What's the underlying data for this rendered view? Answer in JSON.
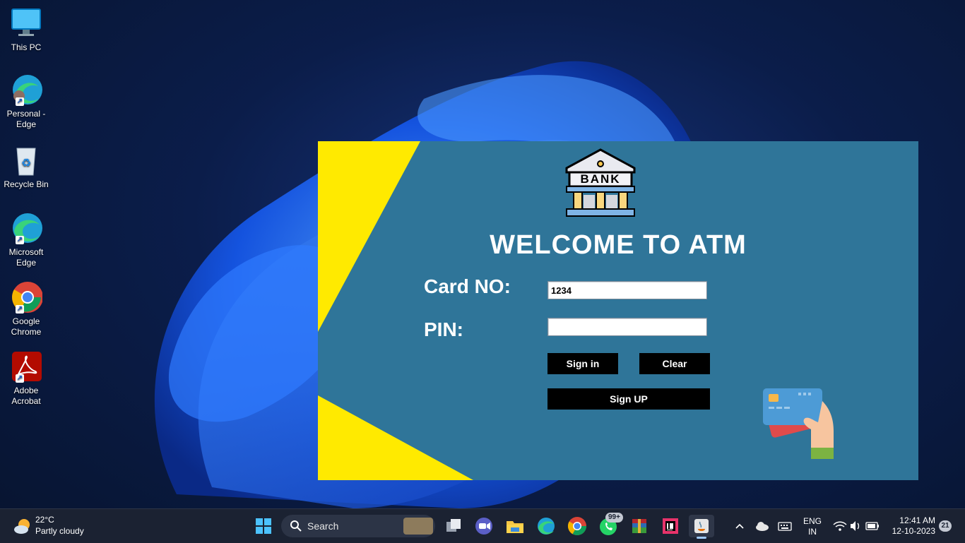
{
  "desktop": {
    "icons": [
      {
        "label": "This PC"
      },
      {
        "label": "Personal - Edge"
      },
      {
        "label": "Recycle Bin"
      },
      {
        "label": "Microsoft Edge"
      },
      {
        "label": "Google Chrome"
      },
      {
        "label": "Adobe Acrobat"
      }
    ]
  },
  "atm": {
    "bank_logo_text": "BANK",
    "title": "WELCOME TO ATM",
    "card_label": "Card NO:",
    "card_value": "1234",
    "pin_label": "PIN:",
    "pin_value": "",
    "signin_label": "Sign in",
    "clear_label": "Clear",
    "signup_label": "Sign UP",
    "colors": {
      "panel": "#2f7599",
      "accent": "#ffea00",
      "button": "#000000"
    }
  },
  "taskbar": {
    "weather_temp": "22°C",
    "weather_desc": "Partly cloudy",
    "search_label": "Search",
    "whatsapp_badge": "99+",
    "lang_top": "ENG",
    "lang_bottom": "IN",
    "time": "12:41 AM",
    "date": "12-10-2023",
    "notification_count": "21"
  }
}
